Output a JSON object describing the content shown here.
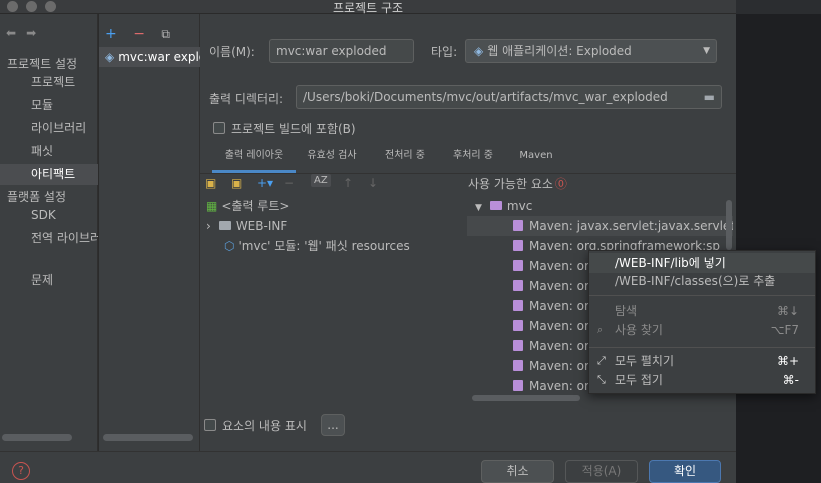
{
  "window": {
    "title": "프로젝트 구조"
  },
  "sidebar": {
    "section_project": "프로젝트 설정",
    "project_items": [
      "프로젝트",
      "모듈",
      "라이브러리",
      "패싯",
      "아티팩트"
    ],
    "section_platform": "플랫폼 설정",
    "platform_items": [
      "SDK",
      "전역 라이브러리"
    ],
    "problems": "문제"
  },
  "artifacts": {
    "item": "mvc:war exploded"
  },
  "form": {
    "name_label": "이름(M):",
    "name_value": "mvc:war exploded",
    "type_label": "타입:",
    "type_value": "웹 애플리케이션: Exploded",
    "output_label": "출력 디렉터리:",
    "output_value": "/Users/boki/Documents/mvc/out/artifacts/mvc_war_exploded",
    "include_build": "프로젝트 빌드에 포함(B)"
  },
  "tabs": [
    "출력 레이아웃",
    "유효성 검사",
    "전처리 중",
    "후처리 중",
    "Maven"
  ],
  "output_tree": {
    "root": "<출력 루트>",
    "webinf": "WEB-INF",
    "module": "'mvc' 모듈: '웹' 패싯 resources"
  },
  "available": {
    "title": "사용 가능한 요소",
    "group": "mvc",
    "items": [
      "Maven: javax.servlet:javax.servlet",
      "Maven: org.springframework:sp",
      "Maven: or",
      "Maven: or",
      "Maven: or",
      "Maven: or",
      "Maven: or",
      "Maven: or",
      "Maven: or"
    ]
  },
  "show_contents": "요소의 내용 표시",
  "ellipsis": "...",
  "buttons": {
    "cancel": "취소",
    "apply": "적용(A)",
    "ok": "확인"
  },
  "context_menu": {
    "put_into_lib": "/WEB-INF/lib에 넣기",
    "extract_classes": "/WEB-INF/classes(으)로 추출",
    "navigate": "탐색",
    "navigate_shortcut": "⌘↓",
    "find_usages": "사용 찾기",
    "find_usages_shortcut": "⌥F7",
    "expand_all": "모두 펼치기",
    "expand_all_shortcut": "⌘+",
    "collapse_all": "모두 접기",
    "collapse_all_shortcut": "⌘-"
  },
  "colors": {
    "accent": "#4a88c7",
    "primary_button": "#365880",
    "help": "#c75450"
  }
}
